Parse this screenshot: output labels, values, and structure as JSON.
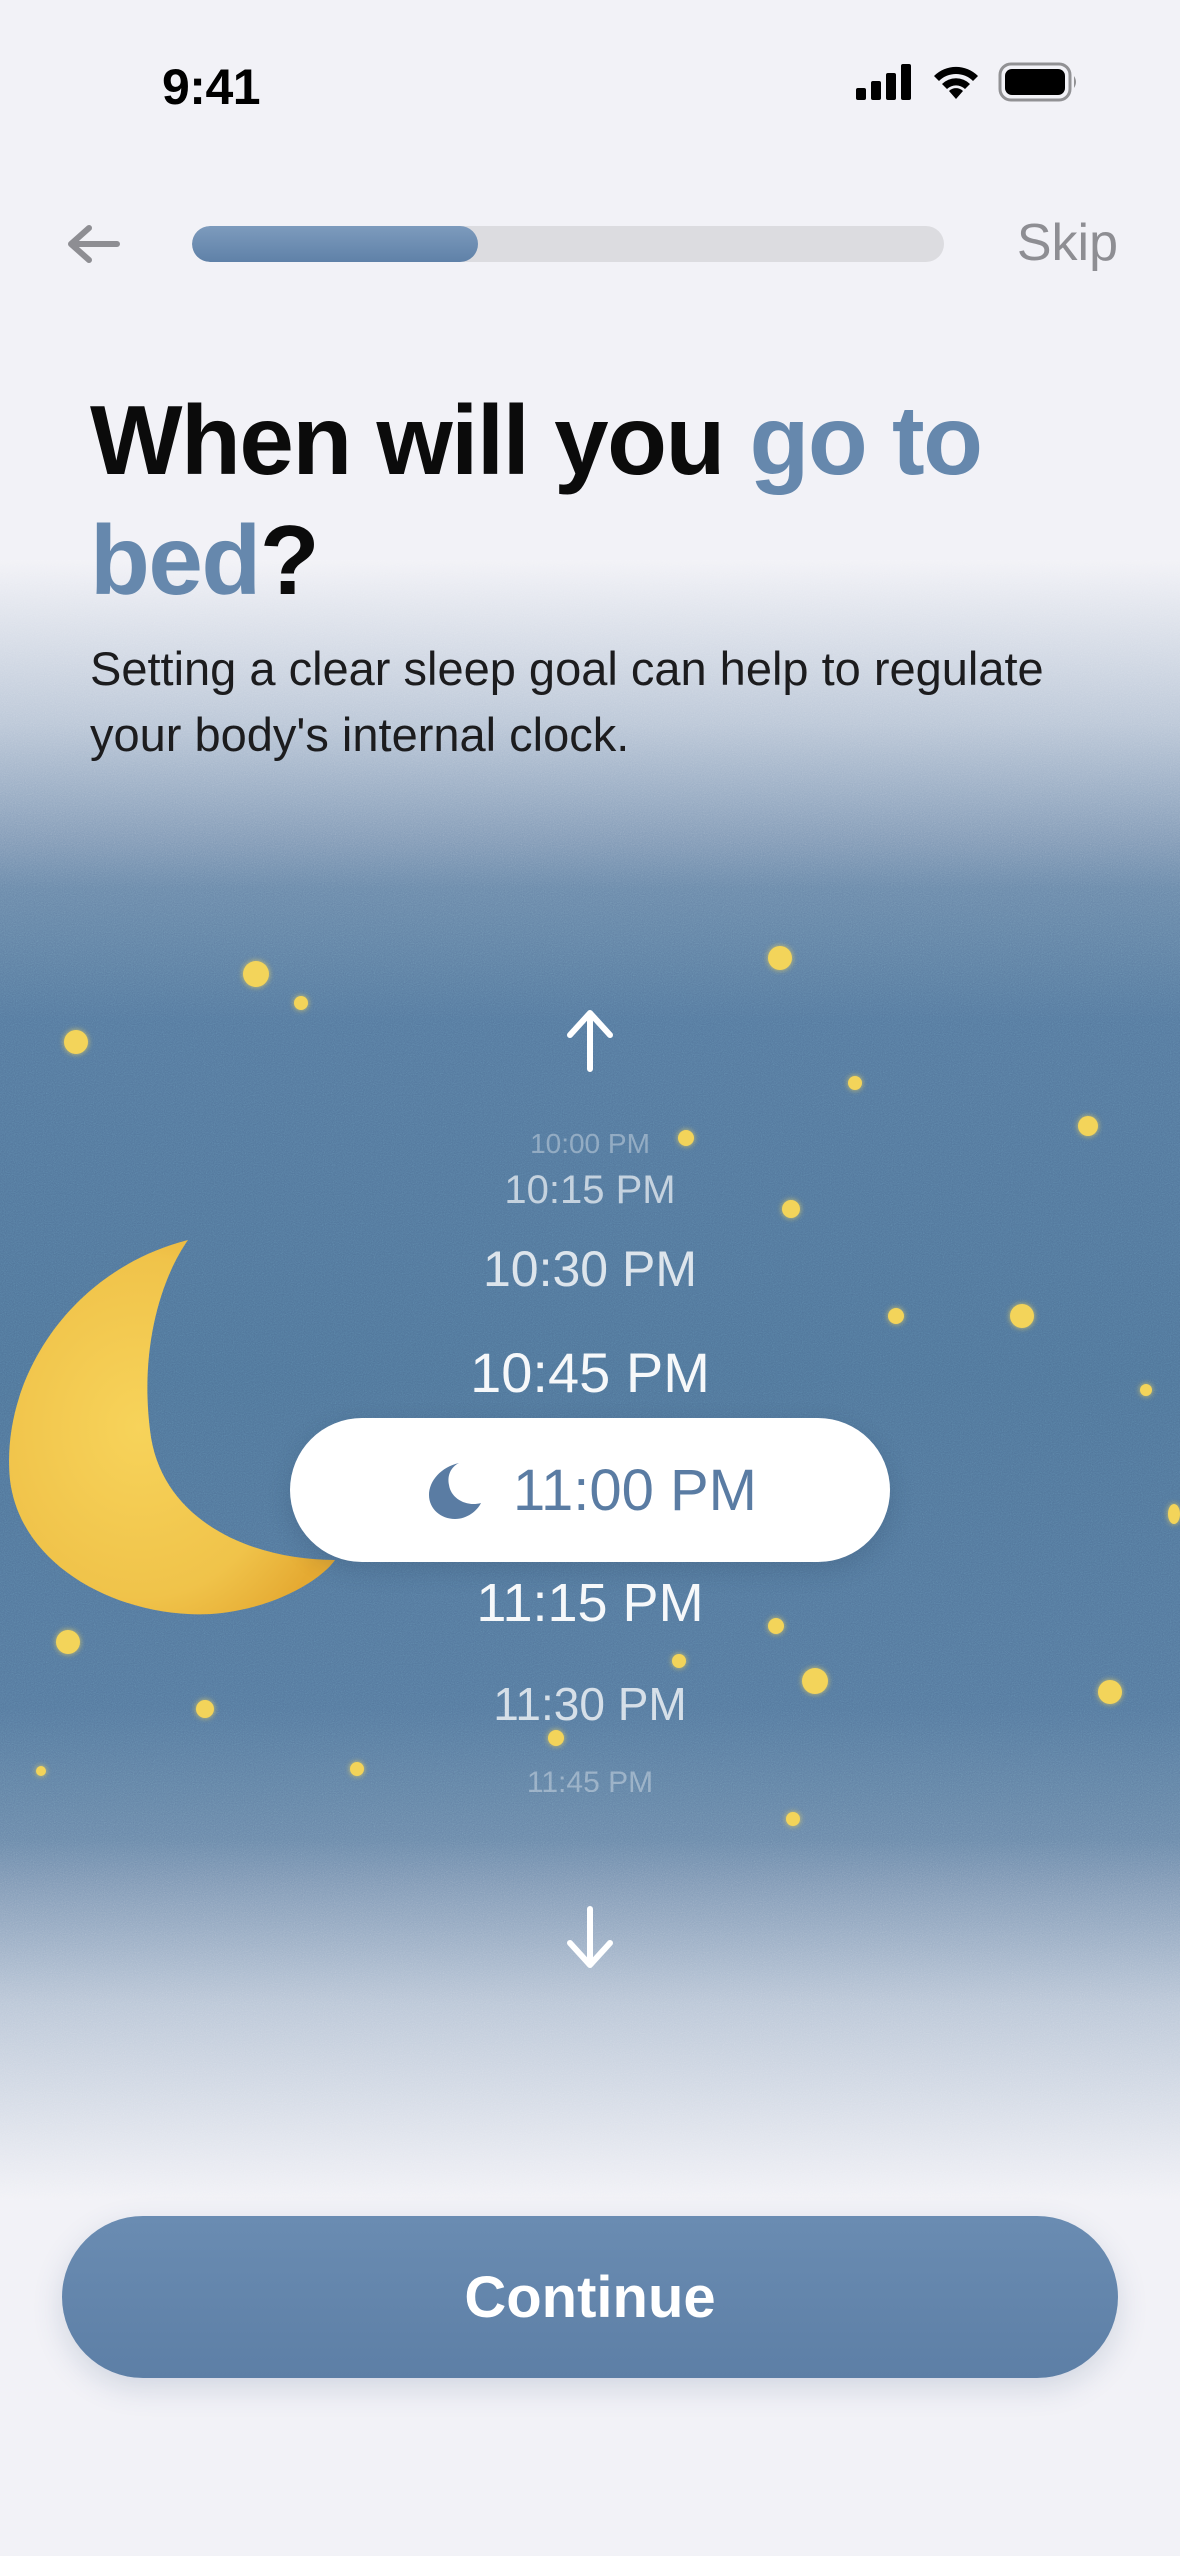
{
  "status_bar": {
    "time": "9:41"
  },
  "nav": {
    "back_icon": "arrow-left-icon",
    "skip_label": "Skip",
    "progress": 0.38
  },
  "header": {
    "title_part1": "When will you ",
    "title_accent": "go to bed",
    "title_end": "?",
    "subtitle": "Setting a clear sleep goal can help to regulate your body's internal clock."
  },
  "picker": {
    "up_icon": "arrow-up-icon",
    "down_icon": "arrow-down-icon",
    "times_above": [
      "10:00 PM",
      "10:15 PM",
      "10:30 PM",
      "10:45 PM"
    ],
    "selected": "11:00 PM",
    "selected_icon": "moon-icon",
    "times_below": [
      "11:15 PM",
      "11:30 PM",
      "11:45 PM"
    ]
  },
  "footer": {
    "continue_label": "Continue"
  },
  "colors": {
    "accent": "#6688ad",
    "sky": "#4f7499",
    "star": "#f3d45a",
    "button": "#6386ad"
  }
}
